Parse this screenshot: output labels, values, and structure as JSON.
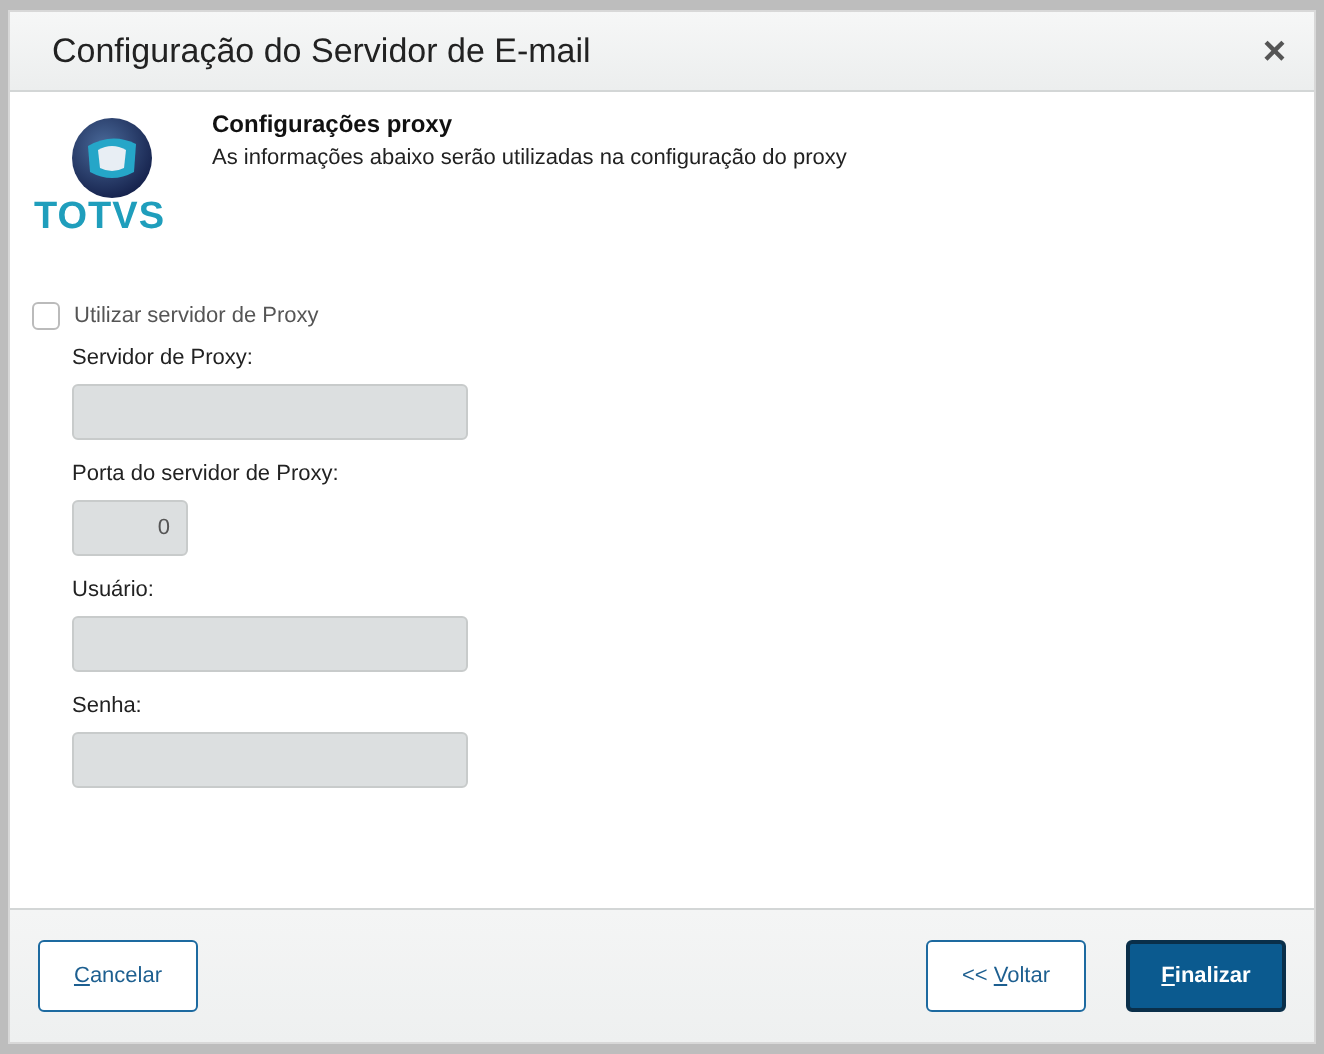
{
  "window": {
    "title": "Configuração do Servidor de E-mail",
    "close": "×"
  },
  "logo": {
    "text": "TOTVS"
  },
  "section": {
    "title": "Configurações proxy",
    "description": "As informações abaixo serão utilizadas na configuração do proxy"
  },
  "checkbox": {
    "label": "Utilizar servidor de Proxy",
    "checked": false
  },
  "fields": [
    {
      "label": "Servidor de Proxy:",
      "kind": "wide",
      "disabled": true
    },
    {
      "label": "Porta do servidor de Proxy:",
      "kind": "narrow",
      "value": "0",
      "disabled": true
    },
    {
      "label": "Usuário:",
      "kind": "wide",
      "disabled": true
    },
    {
      "label": "Senha:",
      "kind": "wide",
      "disabled": true
    }
  ],
  "buttons": [
    {
      "key": "C",
      "after": "ancelar",
      "kind": "secondary"
    },
    {
      "before": "<< ",
      "key": "V",
      "after": "oltar",
      "kind": "secondary"
    },
    {
      "key": "F",
      "after": "inalizar",
      "kind": "primary"
    }
  ]
}
